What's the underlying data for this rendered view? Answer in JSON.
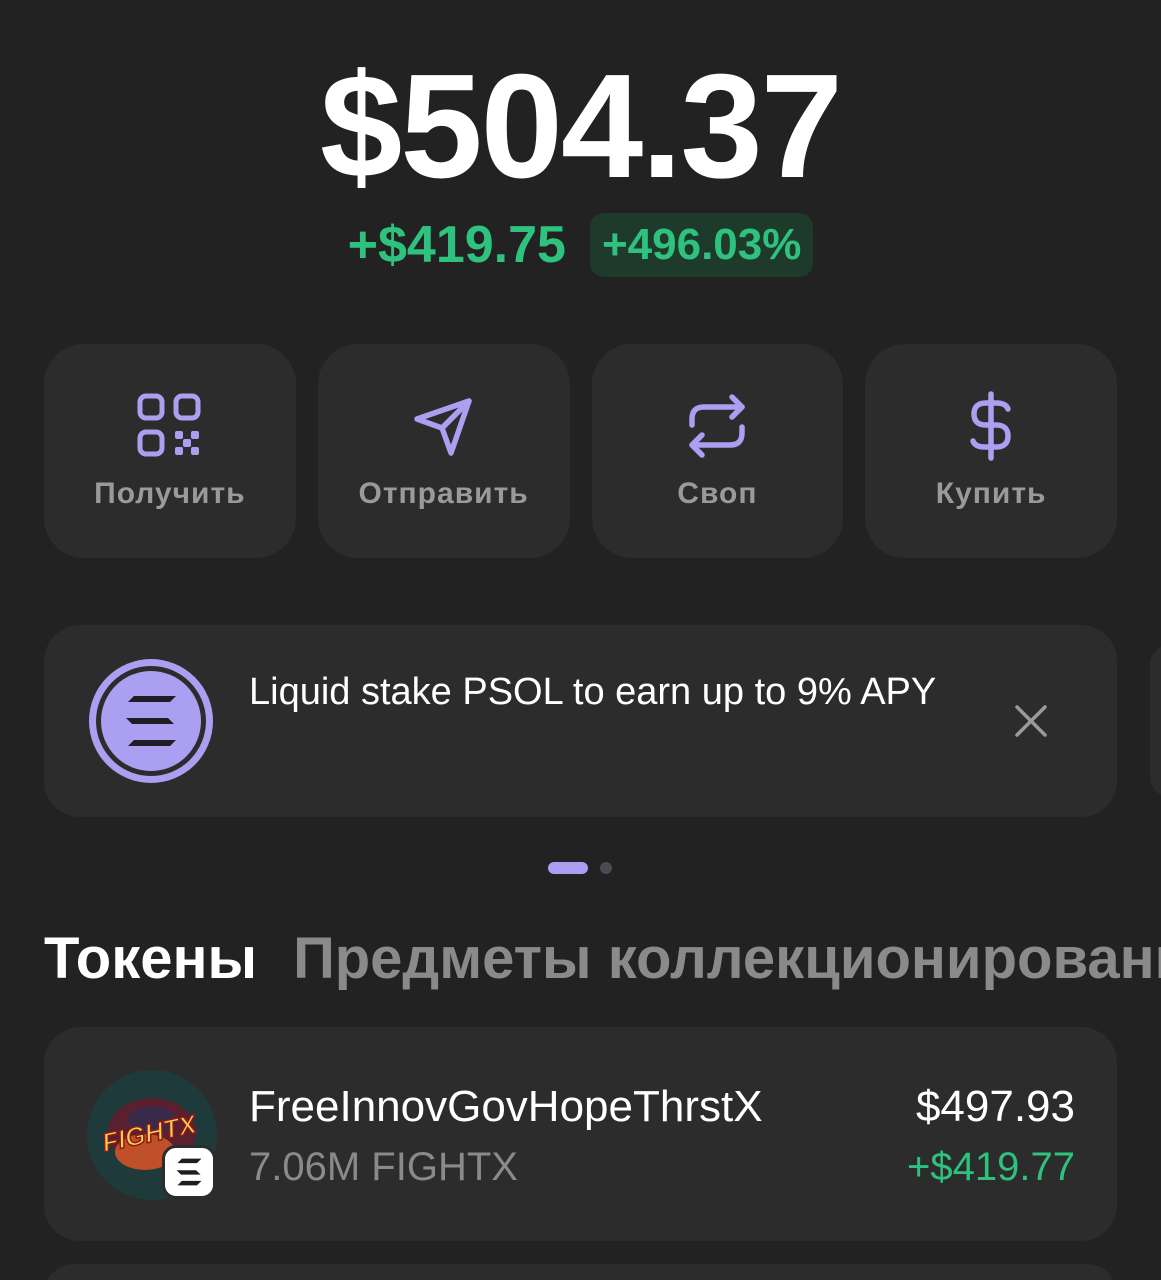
{
  "balance": {
    "total": "$504.37",
    "change_abs": "+$419.75",
    "change_pct": "+496.03%"
  },
  "actions": [
    {
      "label": "Получить",
      "icon": "qr-code-icon"
    },
    {
      "label": "Отправить",
      "icon": "send-icon"
    },
    {
      "label": "Своп",
      "icon": "swap-icon"
    },
    {
      "label": "Купить",
      "icon": "dollar-icon"
    }
  ],
  "promo": {
    "text": "Liquid stake PSOL to earn up to 9% APY",
    "icon": "solana-logo-icon",
    "close_icon": "close-icon"
  },
  "tabs": [
    {
      "label": "Токены",
      "active": true
    },
    {
      "label": "Предметы коллекционировани",
      "active": false
    }
  ],
  "tokens": [
    {
      "name": "FreeInnovGovHopeThrstX",
      "amount": "7.06M FIGHTX",
      "value": "$497.93",
      "change": "+$419.77",
      "logo_text": "FIGHTX"
    }
  ],
  "colors": {
    "background": "#222222",
    "card": "#2c2c2c",
    "accent": "#ab9ff2",
    "positive": "#2ec27e"
  }
}
